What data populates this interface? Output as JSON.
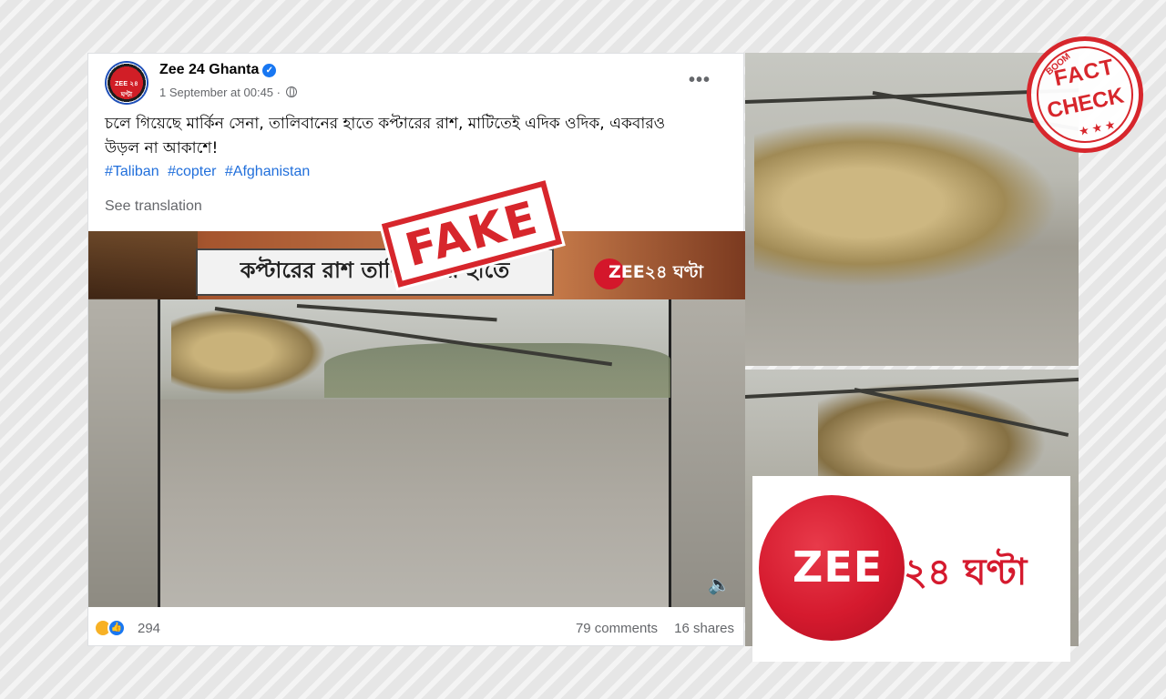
{
  "post": {
    "page_name": "Zee 24 Ghanta",
    "avatar_text": "ZEE ২৪ ঘণ্টা",
    "time": "1 September at 00:45 ·",
    "more": "•••",
    "text": "চলে গিয়েছে মার্কিন সেনা, তালিবানের হাতে কপ্টারের রাশ, মাটিতেই এদিক ওদিক, একবারও উড়ল না আকাশে!",
    "hashtags": [
      "#Taliban",
      "#copter",
      "#Afghanistan"
    ],
    "see_translation": "See translation",
    "fake_label": "FAKE"
  },
  "video": {
    "banner_title": "কপ্টারের রাশ তালিবানের হাতে",
    "banner_logo": "ZEE২৪ ঘণ্টা",
    "volume_icon": "🔈"
  },
  "reactions": {
    "count": "294",
    "comments": "79 comments",
    "shares": "16 shares"
  },
  "logo": {
    "zee": "ZEE",
    "bengali": "২৪ ঘণ্টা"
  },
  "factcheck": {
    "boom": "BOOM",
    "fact": "FACT",
    "check": "CHECK",
    "stars": "★★★"
  },
  "colors": {
    "fb_blue": "#1877f2",
    "stamp_red": "#d7262c",
    "zee_red": "#d51a2e"
  }
}
